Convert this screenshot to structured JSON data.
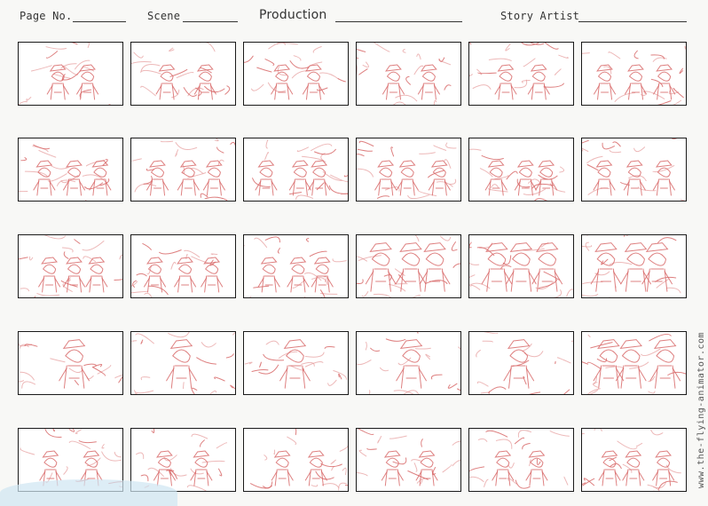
{
  "header": {
    "page_no_label": "Page No.",
    "scene_label": "Scene",
    "production_label": "Production",
    "story_artist_label": "Story Artist"
  },
  "watermark": "www.the-flying-animator.com",
  "grid": {
    "rows": 5,
    "cols": 6
  },
  "colors": {
    "sketch": "#d86a6a",
    "border": "#1a1a1a",
    "paper": "#f8f8f6"
  }
}
